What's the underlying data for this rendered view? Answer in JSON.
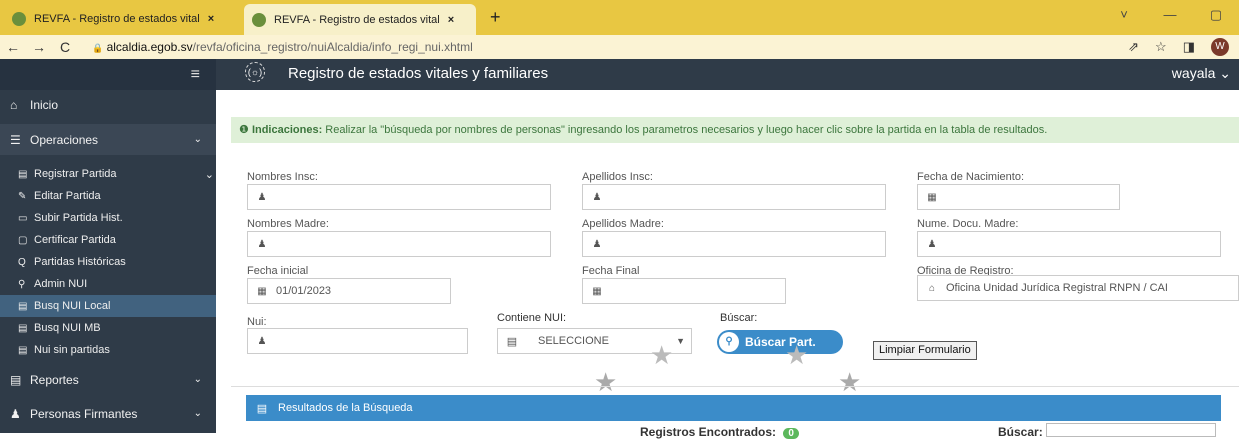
{
  "browser": {
    "tabs": [
      {
        "title": "REVFA - Registro de estados vital",
        "close": "×"
      },
      {
        "title": "REVFA - Registro de estados vital",
        "close": "×"
      }
    ],
    "new_tab": "+",
    "window_controls": [
      "˅",
      "—",
      "▢"
    ],
    "nav": {
      "back": "←",
      "forward": "→",
      "reload": "C",
      "lock": "🔒"
    },
    "url_host": "alcaldia.egob.sv",
    "url_path": "/revfa/oficina_registro/nuiAlcaldia/info_regi_nui.xhtml",
    "right_icons": {
      "share": "⇗",
      "star": "☆",
      "sidepanel": "◨",
      "profile_initial": "W"
    }
  },
  "sidebar": {
    "menu_icon": "≡",
    "inicio": {
      "label": "Inicio",
      "icon": "home-icon",
      "glyph": "⌂"
    },
    "operaciones": {
      "label": "Operaciones",
      "icon": "list-icon",
      "glyph": "☰",
      "chevron": "⌄"
    },
    "submenu": [
      {
        "label": "Registrar Partida",
        "glyph": "▤",
        "chevron": "⌄"
      },
      {
        "label": "Editar Partida",
        "glyph": "✎"
      },
      {
        "label": "Subir Partida Hist.",
        "glyph": "▭"
      },
      {
        "label": "Certificar Partida",
        "glyph": "▢"
      },
      {
        "label": "Partidas Históricas",
        "glyph": "Q"
      },
      {
        "label": "Admin NUI",
        "glyph": "⚲"
      },
      {
        "label": "Busq NUI Local",
        "glyph": "▤"
      },
      {
        "label": "Busq NUI MB",
        "glyph": "▤"
      },
      {
        "label": "Nui sin partidas",
        "glyph": "▤"
      }
    ],
    "reportes": {
      "label": "Reportes",
      "glyph": "▤",
      "chevron": "⌄"
    },
    "personas": {
      "label": "Personas Firmantes",
      "glyph": "♟",
      "chevron": "⌄"
    }
  },
  "header": {
    "logo": "(☼)",
    "title": "Registro de estados vitales y familiares",
    "user": "wayala ⌄"
  },
  "indicaciones": {
    "glyph": "❶",
    "label": "Indicaciones:",
    "text": " Realizar la \"búsqueda por nombres de personas\" ingresando los parametros necesarios y luego hacer clic sobre la partida en la tabla de resultados."
  },
  "form": {
    "nombres_insc": {
      "label": "Nombres Insc:",
      "value": ""
    },
    "apellidos_insc": {
      "label": "Apellidos Insc:",
      "value": ""
    },
    "fecha_nac": {
      "label": "Fecha de Nacimiento:",
      "value": ""
    },
    "nombres_madre": {
      "label": "Nombres Madre:",
      "value": ""
    },
    "apellidos_madre": {
      "label": "Apellidos Madre:",
      "value": ""
    },
    "doc_madre": {
      "label": "Nume. Docu. Madre:",
      "value": ""
    },
    "fecha_inicial": {
      "label": "Fecha inicial",
      "value": "01/01/2023"
    },
    "fecha_final": {
      "label": "Fecha Final",
      "value": ""
    },
    "oficina": {
      "label": "Oficina de Registro:",
      "value": "Oficina Unidad Jurídica Registral RNPN / CAI"
    },
    "nui": {
      "label": "Nui:",
      "value": ""
    },
    "contiene_nui": {
      "label": "Contiene NUI:",
      "value": "SELECCIONE",
      "caret": "▼"
    },
    "buscar_label": "Búscar:",
    "buscar_button": "Búscar Part.",
    "limpiar_button": "Limpiar Formulario",
    "person_glyph": "♟",
    "calendar_glyph": "▦",
    "home_glyph": "⌂",
    "doc_glyph": "▤",
    "search_glyph": "⚲"
  },
  "results": {
    "glyph": "▤",
    "title": "Resultados de la Búsqueda",
    "count_label": "Registros Encontrados:",
    "count": "0",
    "search_label": "Búscar:"
  }
}
